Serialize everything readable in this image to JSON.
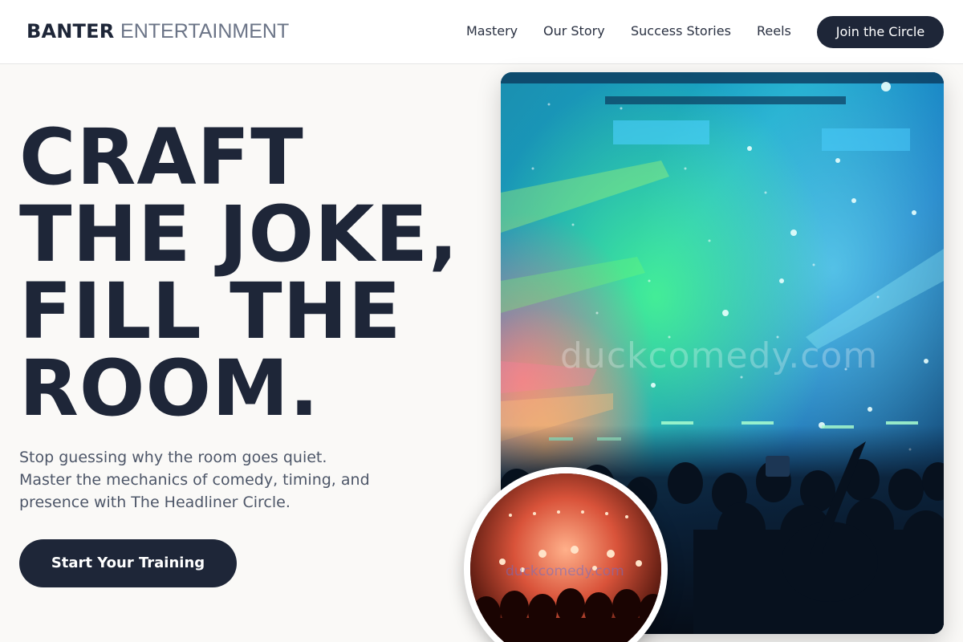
{
  "header": {
    "brand_bold": "BANTER",
    "brand_light": "ENTERTAINMENT",
    "nav": [
      "Mastery",
      "Our Story",
      "Success Stories",
      "Reels"
    ],
    "cta_label": "Join the Circle"
  },
  "hero": {
    "headline_lines": [
      "CRAFT",
      "THE JOKE,",
      "FILL THE",
      "ROOM."
    ],
    "subtext": "Stop guessing why the room goes quiet. Master the mechanics of comedy, timing, and presence with The Headliner Circle.",
    "button_label": "Start Your Training"
  },
  "media": {
    "main_image_watermark": "duckcomedy.com",
    "inset_image_watermark": "duckcomedy.com"
  },
  "colors": {
    "primary": "#1e2638",
    "background": "#faf9f7",
    "muted_text": "#4d5668"
  }
}
